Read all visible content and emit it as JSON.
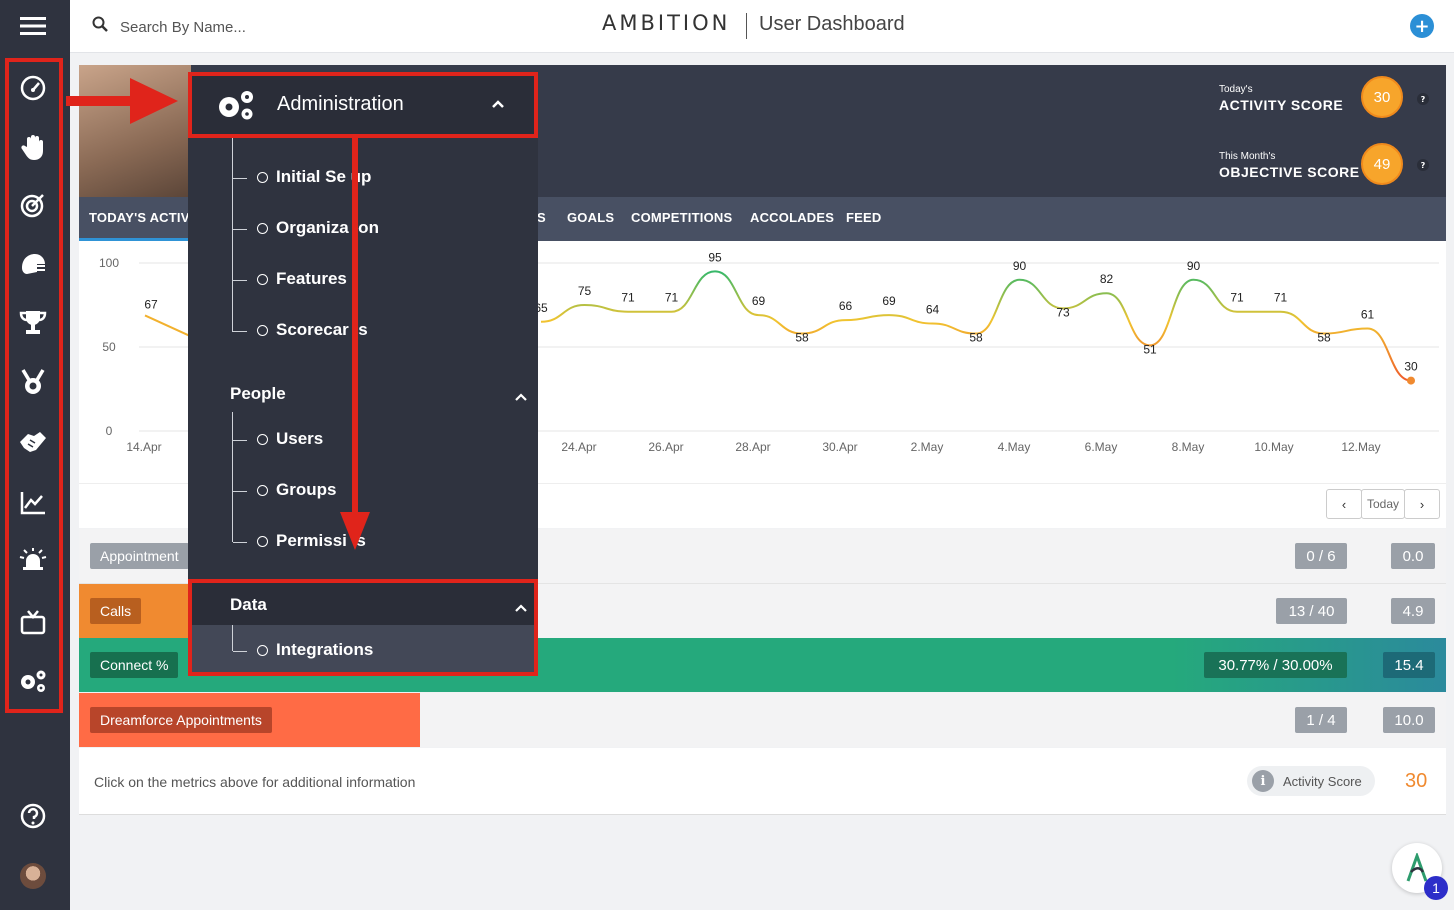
{
  "search": {
    "placeholder": "Search By Name..."
  },
  "brand": {
    "logo": "AMBITION",
    "page_title": "User Dashboard"
  },
  "header": {
    "activity": {
      "caption": "Today's",
      "title": "ACTIVITY SCORE",
      "value": "30"
    },
    "objective": {
      "caption": "This Month's",
      "title": "OBJECTIVE SCORE",
      "value": "49"
    },
    "help": "?"
  },
  "tabs": [
    "TODAY'S ACTIVI",
    "S",
    "GOALS",
    "COMPETITIONS",
    "ACCOLADES",
    "FEED"
  ],
  "chart_data": {
    "type": "line",
    "y_ticks": [
      "100",
      "50",
      "0"
    ],
    "ylim": [
      0,
      100
    ],
    "x_ticks": [
      "14.Apr",
      "24.Apr",
      "26.Apr",
      "28.Apr",
      "30.Apr",
      "2.May",
      "4.May",
      "6.May",
      "8.May",
      "10.May",
      "12.May"
    ],
    "points_left": [
      {
        "label": "67",
        "value": 67
      }
    ],
    "points_right": [
      {
        "label": "65",
        "value": 65
      },
      {
        "label": "75",
        "value": 75
      },
      {
        "label": "71",
        "value": 71
      },
      {
        "label": "71",
        "value": 71
      },
      {
        "label": "95",
        "value": 95
      },
      {
        "label": "69",
        "value": 69
      },
      {
        "label": "58",
        "value": 58
      },
      {
        "label": "66",
        "value": 66
      },
      {
        "label": "69",
        "value": 69
      },
      {
        "label": "64",
        "value": 64
      },
      {
        "label": "58",
        "value": 58
      },
      {
        "label": "90",
        "value": 90
      },
      {
        "label": "73",
        "value": 73
      },
      {
        "label": "82",
        "value": 82
      },
      {
        "label": "51",
        "value": 51
      },
      {
        "label": "90",
        "value": 90
      },
      {
        "label": "71",
        "value": 71
      },
      {
        "label": "71",
        "value": 71
      },
      {
        "label": "58",
        "value": 58
      },
      {
        "label": "61",
        "value": 61
      },
      {
        "label": "30",
        "value": 30
      }
    ],
    "grid": true
  },
  "chart_nav": {
    "prev": "‹",
    "today": "Today",
    "next": "›"
  },
  "metrics": [
    {
      "label": "Appointment",
      "value": "0 / 6",
      "score": "0.0",
      "color": "#9aa0a8"
    },
    {
      "label": "Calls",
      "value": "13 / 40",
      "score": "4.9",
      "color": "#f08a30"
    },
    {
      "label": "Connect %",
      "value": "30.77% / 30.00%",
      "score": "15.4",
      "color": "#25a97c"
    },
    {
      "label": "Dreamforce Appointments",
      "value": "1 / 4",
      "score": "10.0",
      "color": "#ff6b45"
    }
  ],
  "footer": {
    "hint": "Click on the metrics above for additional information",
    "info": "i",
    "activity_label": "Activity Score",
    "activity_value": "30"
  },
  "menu": {
    "administration": "Administration",
    "admin_items": [
      "Initial Se up",
      "Organiza ion",
      "Features",
      "Scorecar ls"
    ],
    "people": "People",
    "people_items": [
      "Users",
      "Groups",
      "Permissi  s"
    ],
    "data": "Data",
    "data_items": [
      "Integrations"
    ]
  },
  "notification_count": "1"
}
